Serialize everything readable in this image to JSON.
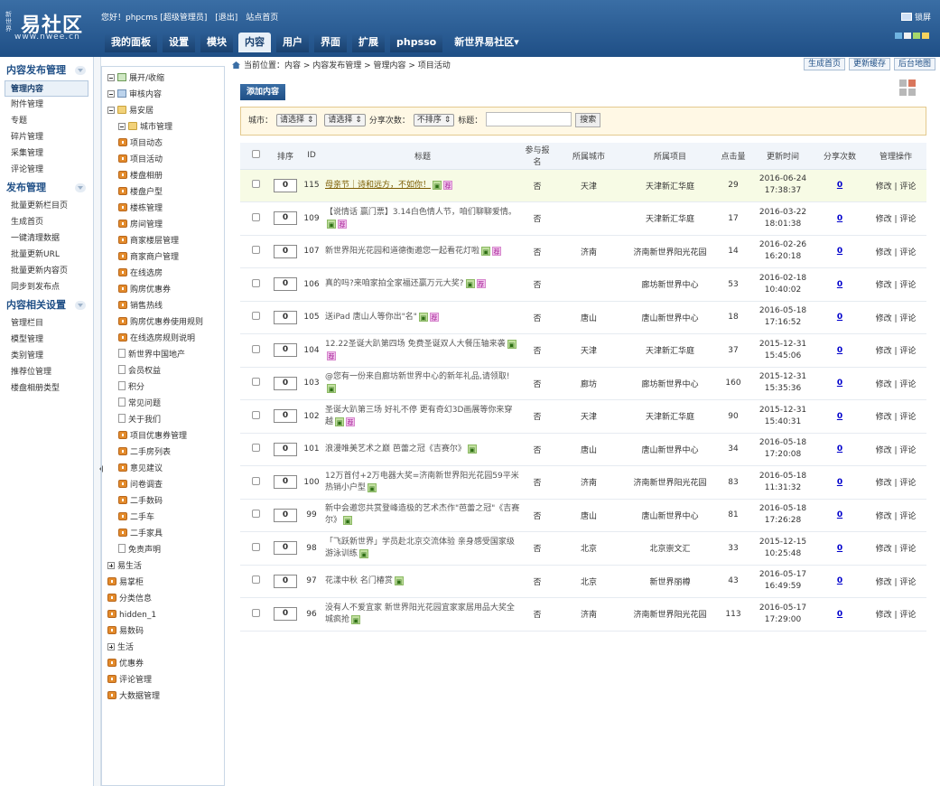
{
  "brand": {
    "mark": "新世界",
    "name": "易社区",
    "url": "www.nwee.cn"
  },
  "toplinks": {
    "greeting": "您好！phpcms [超级管理员]",
    "logout": "[退出]",
    "site_home": "站点首页"
  },
  "lock_screen": "锁屏",
  "nav": {
    "items": [
      "我的面板",
      "设置",
      "模块",
      "内容",
      "用户",
      "界面",
      "扩展",
      "phpsso",
      "新世界易社区▾"
    ],
    "active_index": 3
  },
  "sidebar": {
    "groups": [
      {
        "title": "内容发布管理",
        "items": [
          "管理内容",
          "附件管理",
          "专题",
          "碎片管理",
          "采集管理",
          "评论管理"
        ]
      },
      {
        "title": "发布管理",
        "items": [
          "批量更新栏目页",
          "生成首页",
          "一键清理数据",
          "批量更新URL",
          "批量更新内容页",
          "同步到发布点"
        ]
      },
      {
        "title": "内容相关设置",
        "items": [
          "管理栏目",
          "模型管理",
          "类别管理",
          "推荐位管理",
          "楼盘相册类型"
        ]
      }
    ]
  },
  "tree": [
    {
      "label": "展开/收缩",
      "type": "list",
      "indent": 0
    },
    {
      "label": "审核内容",
      "type": "mon",
      "indent": 0
    },
    {
      "label": "易安居",
      "type": "folder",
      "indent": 0
    },
    {
      "label": "城市管理",
      "type": "folder",
      "indent": 1
    },
    {
      "label": "项目动态",
      "type": "leaf",
      "indent": 1
    },
    {
      "label": "项目活动",
      "type": "leaf",
      "indent": 1
    },
    {
      "label": "楼盘相册",
      "type": "leaf",
      "indent": 1
    },
    {
      "label": "楼盘户型",
      "type": "leaf",
      "indent": 1
    },
    {
      "label": "楼栋管理",
      "type": "leaf",
      "indent": 1
    },
    {
      "label": "房间管理",
      "type": "leaf",
      "indent": 1
    },
    {
      "label": "商家楼层管理",
      "type": "leaf",
      "indent": 1
    },
    {
      "label": "商家商户管理",
      "type": "leaf",
      "indent": 1
    },
    {
      "label": "在线选房",
      "type": "leaf",
      "indent": 1
    },
    {
      "label": "购房优惠券",
      "type": "leaf",
      "indent": 1
    },
    {
      "label": "销售热线",
      "type": "leaf",
      "indent": 1
    },
    {
      "label": "购房优惠券使用规则",
      "type": "leaf",
      "indent": 1
    },
    {
      "label": "在线选房规则说明",
      "type": "leaf",
      "indent": 1
    },
    {
      "label": "新世界中国地产",
      "type": "page",
      "indent": 1
    },
    {
      "label": "会员权益",
      "type": "page",
      "indent": 1
    },
    {
      "label": "积分",
      "type": "page",
      "indent": 1
    },
    {
      "label": "常见问题",
      "type": "page",
      "indent": 1
    },
    {
      "label": "关于我们",
      "type": "page",
      "indent": 1
    },
    {
      "label": "项目优惠券管理",
      "type": "leaf",
      "indent": 1
    },
    {
      "label": "二手房列表",
      "type": "leaf",
      "indent": 1
    },
    {
      "label": "意见建议",
      "type": "leaf",
      "indent": 1
    },
    {
      "label": "问卷调查",
      "type": "leaf",
      "indent": 1
    },
    {
      "label": "二手数码",
      "type": "leaf",
      "indent": 1
    },
    {
      "label": "二手车",
      "type": "leaf",
      "indent": 1
    },
    {
      "label": "二手家具",
      "type": "leaf",
      "indent": 1
    },
    {
      "label": "免责声明",
      "type": "page",
      "indent": 1
    },
    {
      "label": "易生活",
      "type": "plus",
      "indent": 0
    },
    {
      "label": "易掌柜",
      "type": "leaf",
      "indent": 0
    },
    {
      "label": "分类信息",
      "type": "leaf",
      "indent": 0
    },
    {
      "label": "hidden_1",
      "type": "leaf",
      "indent": 0
    },
    {
      "label": "易数码",
      "type": "leaf",
      "indent": 0
    },
    {
      "label": "生活",
      "type": "plus",
      "indent": 0
    },
    {
      "label": "优惠券",
      "type": "leaf",
      "indent": 0
    },
    {
      "label": "评论管理",
      "type": "leaf",
      "indent": 0
    },
    {
      "label": "大数据管理",
      "type": "leaf",
      "indent": 0
    }
  ],
  "breadcrumb": "当前位置：内容 > 内容发布管理 > 管理内容 > 项目活动",
  "top_buttons": [
    "生成首页",
    "更新缓存",
    "后台地图"
  ],
  "add_button": "添加内容",
  "search": {
    "city_label": "城市：",
    "select1": "请选择 ⇕",
    "select2": "请选择 ⇕",
    "share_label": "分享次数：",
    "share_select": "不排序 ⇕",
    "title_label": "标题：",
    "submit": "搜索"
  },
  "table": {
    "headers": [
      "排序",
      "ID",
      "标题",
      "参与报名",
      "所属城市",
      "所属项目",
      "点击量",
      "更新时间",
      "分享次数",
      "管理操作"
    ],
    "rows": [
      {
        "order": "0",
        "id": "115",
        "title": "母亲节｜诗和远方，不如你！",
        "tags": [
          "g",
          "p"
        ],
        "join": "否",
        "city": "天津",
        "project": "天津新汇华庭",
        "clicks": "29",
        "date": "2016-06-24",
        "time": "17:38:37",
        "shares": "0",
        "ops": "修改 | 评论",
        "highlight": true
      },
      {
        "order": "0",
        "id": "109",
        "title": "【说情话 赢门票】3.14白色情人节，咱们聊聊爱情。",
        "tags": [
          "g",
          "p"
        ],
        "join": "否",
        "city": "",
        "project": "天津新汇华庭",
        "clicks": "17",
        "date": "2016-03-22",
        "time": "18:01:38",
        "shares": "0",
        "ops": "修改 | 评论"
      },
      {
        "order": "0",
        "id": "107",
        "title": "新世界阳光花园和道德衡邀您一起看花灯啦",
        "tags": [
          "g",
          "p"
        ],
        "join": "否",
        "city": "济南",
        "project": "济南新世界阳光花园",
        "clicks": "14",
        "date": "2016-02-26",
        "time": "16:20:18",
        "shares": "0",
        "ops": "修改 | 评论"
      },
      {
        "order": "0",
        "id": "106",
        "title": "真的吗?来咱家拍全家福还赢万元大奖?",
        "tags": [
          "g",
          "p"
        ],
        "join": "否",
        "city": "",
        "project": "廊坊新世界中心",
        "clicks": "53",
        "date": "2016-02-18",
        "time": "10:40:02",
        "shares": "0",
        "ops": "修改 | 评论"
      },
      {
        "order": "0",
        "id": "105",
        "title": "送iPad 唐山人等你出\"名\"",
        "tags": [
          "g",
          "p"
        ],
        "join": "否",
        "city": "唐山",
        "project": "唐山新世界中心",
        "clicks": "18",
        "date": "2016-05-18",
        "time": "17:16:52",
        "shares": "0",
        "ops": "修改 | 评论"
      },
      {
        "order": "0",
        "id": "104",
        "title": "12.22圣诞大趴第四场 免费圣诞双人大餐压轴来袭",
        "tags": [
          "g",
          "p"
        ],
        "join": "否",
        "city": "天津",
        "project": "天津新汇华庭",
        "clicks": "37",
        "date": "2015-12-31",
        "time": "15:45:06",
        "shares": "0",
        "ops": "修改 | 评论"
      },
      {
        "order": "0",
        "id": "103",
        "title": "@您有一份来自廊坊新世界中心的新年礼品,请领取!",
        "tags": [
          "g"
        ],
        "join": "否",
        "city": "廊坊",
        "project": "廊坊新世界中心",
        "clicks": "160",
        "date": "2015-12-31",
        "time": "15:35:36",
        "shares": "0",
        "ops": "修改 | 评论"
      },
      {
        "order": "0",
        "id": "102",
        "title": "圣诞大趴第三场 好礼不停 更有奇幻3D画展等你来穿越",
        "tags": [
          "g",
          "p"
        ],
        "join": "否",
        "city": "天津",
        "project": "天津新汇华庭",
        "clicks": "90",
        "date": "2015-12-31",
        "time": "15:40:31",
        "shares": "0",
        "ops": "修改 | 评论"
      },
      {
        "order": "0",
        "id": "101",
        "title": "浪漫唯美艺术之巅 芭蕾之冠《吉赛尔》",
        "tags": [
          "g"
        ],
        "join": "否",
        "city": "唐山",
        "project": "唐山新世界中心",
        "clicks": "34",
        "date": "2016-05-18",
        "time": "17:20:08",
        "shares": "0",
        "ops": "修改 | 评论"
      },
      {
        "order": "0",
        "id": "100",
        "title": "12万首付+2万电器大奖=济南新世界阳光花园59平米热销小户型",
        "tags": [
          "g"
        ],
        "join": "否",
        "city": "济南",
        "project": "济南新世界阳光花园",
        "clicks": "83",
        "date": "2016-05-18",
        "time": "11:31:32",
        "shares": "0",
        "ops": "修改 | 评论"
      },
      {
        "order": "0",
        "id": "99",
        "title": "新中会邀您共赏登峰造极的艺术杰作\"芭蕾之冠\"《吉赛尔》",
        "tags": [
          "g"
        ],
        "join": "否",
        "city": "唐山",
        "project": "唐山新世界中心",
        "clicks": "81",
        "date": "2016-05-18",
        "time": "17:26:28",
        "shares": "0",
        "ops": "修改 | 评论"
      },
      {
        "order": "0",
        "id": "98",
        "title": "「飞跃新世界」学员赴北京交流体验 亲身感受国家级游泳训练",
        "tags": [
          "g"
        ],
        "join": "否",
        "city": "北京",
        "project": "北京崇文汇",
        "clicks": "33",
        "date": "2015-12-15",
        "time": "10:25:48",
        "shares": "0",
        "ops": "修改 | 评论"
      },
      {
        "order": "0",
        "id": "97",
        "title": "花漾中秋 名门椿赏",
        "tags": [
          "g"
        ],
        "join": "否",
        "city": "北京",
        "project": "新世界丽樽",
        "clicks": "43",
        "date": "2016-05-17",
        "time": "16:49:59",
        "shares": "0",
        "ops": "修改 | 评论"
      },
      {
        "order": "0",
        "id": "96",
        "title": "没有人不爱宜家 新世界阳光花园宜家家居用品大奖全城疯抢",
        "tags": [
          "g"
        ],
        "join": "否",
        "city": "济南",
        "project": "济南新世界阳光花园",
        "clicks": "113",
        "date": "2016-05-17",
        "time": "17:29:00",
        "shares": "0",
        "ops": "修改 | 评论"
      }
    ]
  },
  "colors": {
    "header_top": "#3a6ea5",
    "header_bottom": "#1f4f86",
    "highlight_row": "#f7fbe5",
    "search_bg": "#fff8e5",
    "swatches": [
      "#6fb3e0",
      "#f0f0f0",
      "#a7d86b",
      "#f5d25e"
    ]
  }
}
